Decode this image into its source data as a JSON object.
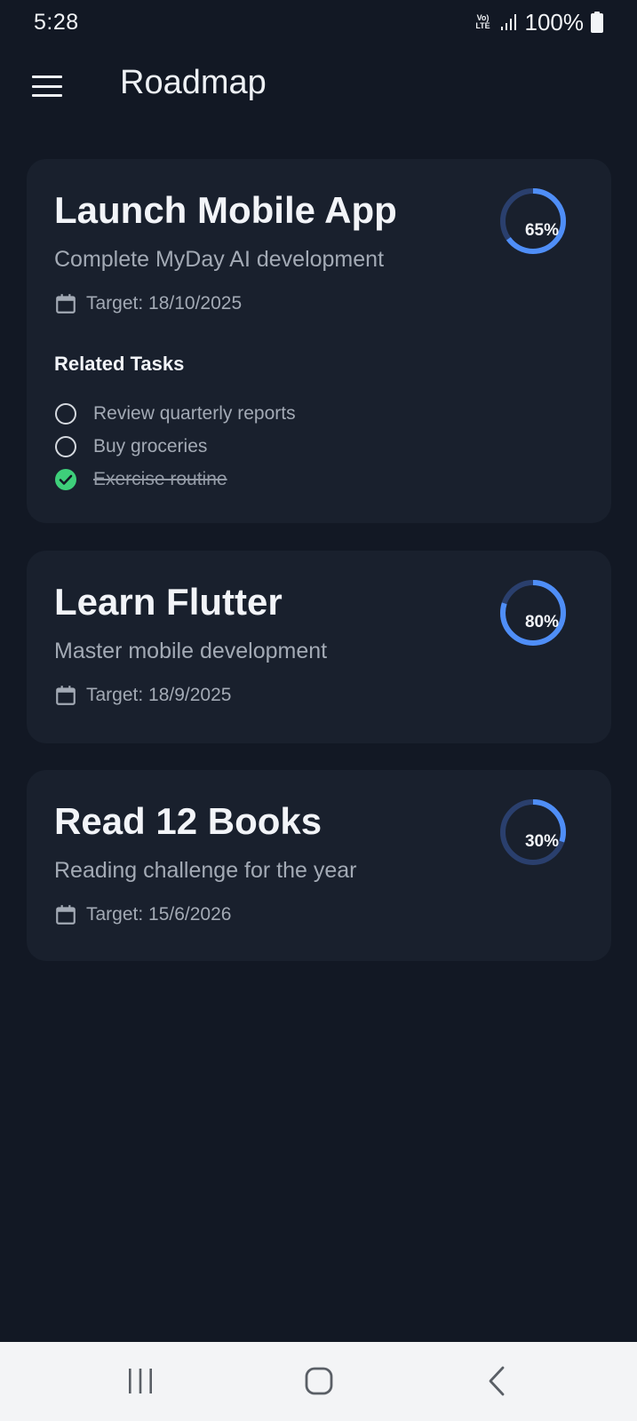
{
  "status_bar": {
    "time": "5:28",
    "network": "Vo) LTE",
    "battery": "100%"
  },
  "app_bar": {
    "title": "Roadmap"
  },
  "goals": [
    {
      "title": "Launch Mobile App",
      "subtitle": "Complete MyDay AI development",
      "target": "Target: 18/10/2025",
      "progress_label": "65%",
      "progress": 0.65,
      "related_heading": "Related Tasks",
      "tasks": [
        {
          "label": "Review quarterly reports",
          "done": false
        },
        {
          "label": "Buy groceries",
          "done": false
        },
        {
          "label": "Exercise routine",
          "done": true
        }
      ]
    },
    {
      "title": "Learn Flutter",
      "subtitle": "Master mobile development",
      "target": "Target: 18/9/2025",
      "progress_label": "80%",
      "progress": 0.8
    },
    {
      "title": "Read 12 Books",
      "subtitle": "Reading challenge for the year",
      "target": "Target: 15/6/2026",
      "progress_label": "30%",
      "progress": 0.3
    }
  ],
  "colors": {
    "background": "#121824",
    "card": "#19202d",
    "accent": "#4f8ef7",
    "ring_track": "#2a3f6d",
    "done": "#3ecf7a"
  },
  "nav_bar": {
    "recents_icon": "recents-icon",
    "home_icon": "home-icon",
    "back_icon": "back-icon"
  }
}
